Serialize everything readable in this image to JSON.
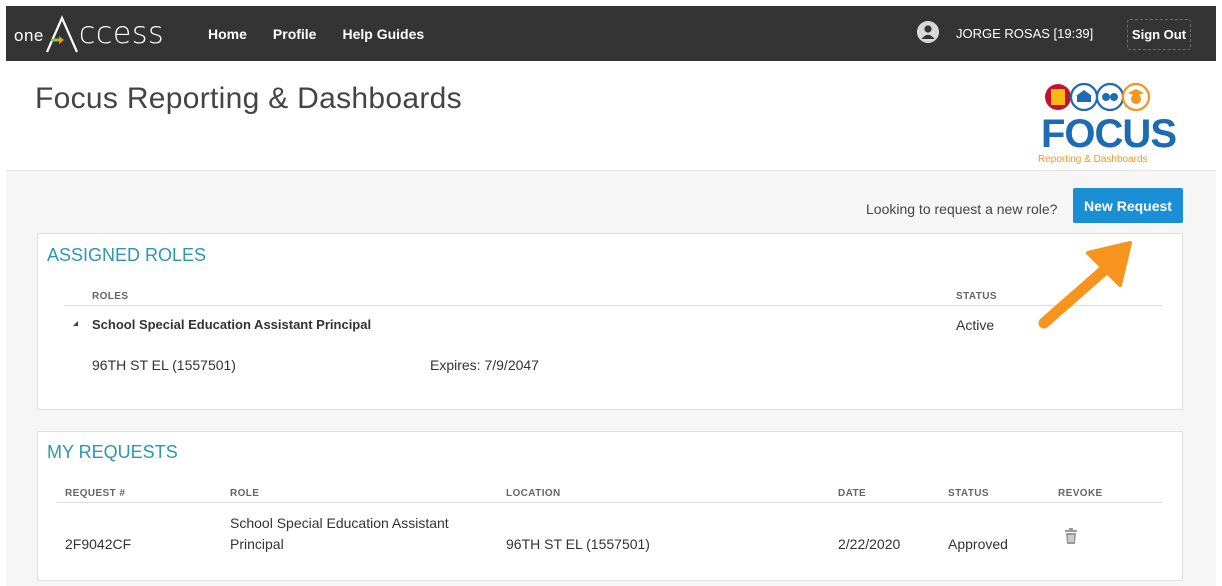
{
  "topbar": {
    "logo": {
      "prefix": "one",
      "suffix": "ccess"
    },
    "nav": [
      "Home",
      "Profile",
      "Help Guides"
    ],
    "user": "JORGE ROSAS [19:39]",
    "sign_out": "Sign Out"
  },
  "header": {
    "title": "Focus Reporting & Dashboards",
    "brand": {
      "word": "FOCUS",
      "sub_a": "Reporting",
      "sub_amp": " & ",
      "sub_b": "Dashboards"
    }
  },
  "toolbar": {
    "prompt": "Looking to request a new role?",
    "new_request": "New Request"
  },
  "assigned_roles": {
    "title": "ASSIGNED ROLES",
    "columns": {
      "roles": "ROLES",
      "status": "STATUS"
    },
    "rows": [
      {
        "role": "School Special Education Assistant Principal",
        "status": "Active",
        "location": "96TH ST EL (1557501)",
        "expires": "Expires: 7/9/2047"
      }
    ]
  },
  "my_requests": {
    "title": "MY REQUESTS",
    "columns": {
      "request": "REQUEST #",
      "role": "ROLE",
      "location": "LOCATION",
      "date": "DATE",
      "status": "STATUS",
      "revoke": "REVOKE"
    },
    "rows": [
      {
        "request": "2F9042CF",
        "role_line1": "School Special Education Assistant",
        "role_line2": "Principal",
        "location": "96TH ST EL (1557501)",
        "date": "2/22/2020",
        "status": "Approved",
        "revoke_icon": "trash-icon"
      }
    ]
  },
  "colors": {
    "topbar_bg": "#343434",
    "accent_teal": "#2b97b7",
    "button_blue": "#1b8fd5",
    "arrow_orange": "#f7941d",
    "focus_blue": "#1d6bb4"
  }
}
